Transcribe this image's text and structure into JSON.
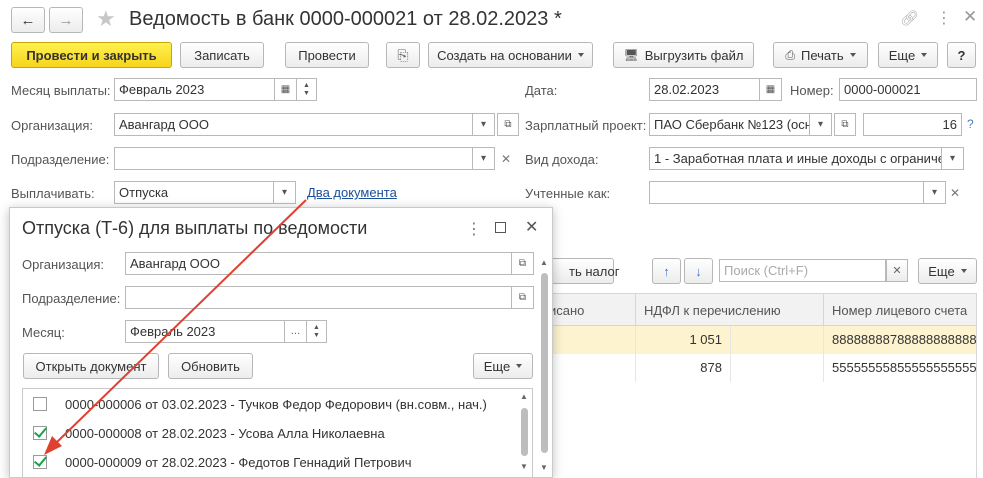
{
  "window": {
    "title": "Ведомость в банк 0000-000021 от 28.02.2023 *"
  },
  "toolbar": {
    "post_close": "Провести и закрыть",
    "save": "Записать",
    "post": "Провести",
    "create_based_on": "Создать на основании",
    "export_file": "Выгрузить файл",
    "print": "Печать",
    "more": "Еще",
    "help": "?"
  },
  "form": {
    "month_label": "Месяц выплаты:",
    "month_value": "Февраль 2023",
    "date_label": "Дата:",
    "date_value": "28.02.2023",
    "number_label": "Номер:",
    "number_value": "0000-000021",
    "org_label": "Организация:",
    "org_value": "Авангард ООО",
    "salary_project_label": "Зарплатный проект:",
    "salary_project_value": "ПАО Сбербанк №123 (осн",
    "salary_project_count": "16",
    "subdivision_label": "Подразделение:",
    "subdivision_value": "",
    "income_type_label": "Вид дохода:",
    "income_type_value": "1 - Заработная плата и иные доходы с ограниче",
    "pay_label": "Выплачивать:",
    "pay_value": "Отпуска",
    "documents_link": "Два документа",
    "accounted_label": "Учтенные как:",
    "accounted_value": ""
  },
  "table_toolbar": {
    "tax_button_partial": "ть налог",
    "search_placeholder": "Поиск (Ctrl+F)",
    "more": "Еще"
  },
  "table": {
    "columns": [
      "исано",
      "НДФЛ к перечислению",
      "Номер лицевого счета"
    ],
    "rows": [
      {
        "ndfl": "1 051",
        "account": "88888888788888888888"
      },
      {
        "ndfl": "878",
        "account": "55555555855555555555"
      }
    ]
  },
  "dialog": {
    "title": "Отпуска (Т-6) для выплаты по ведомости",
    "org_label": "Организация:",
    "org_value": "Авангард ООО",
    "subdivision_label": "Подразделение:",
    "subdivision_value": "",
    "month_label": "Месяц:",
    "month_value": "Февраль 2023",
    "open_doc": "Открыть документ",
    "refresh": "Обновить",
    "more": "Еще",
    "items": [
      {
        "text": "0000-000006 от 03.02.2023 - Тучков Федор Федорович (вн.совм., нач.)",
        "checked": false
      },
      {
        "text": "0000-000008 от 28.02.2023 - Усова Алла Николаевна",
        "checked": true
      },
      {
        "text": "0000-000009 от 28.02.2023 - Федотов Геннадий Петрович",
        "checked": true
      }
    ]
  },
  "colors": {
    "primary_button": "#f7d41a",
    "link": "#1a4f9c",
    "selected_row": "#fdf3cf",
    "arrow": "#e04030",
    "check": "#1aa34a"
  }
}
